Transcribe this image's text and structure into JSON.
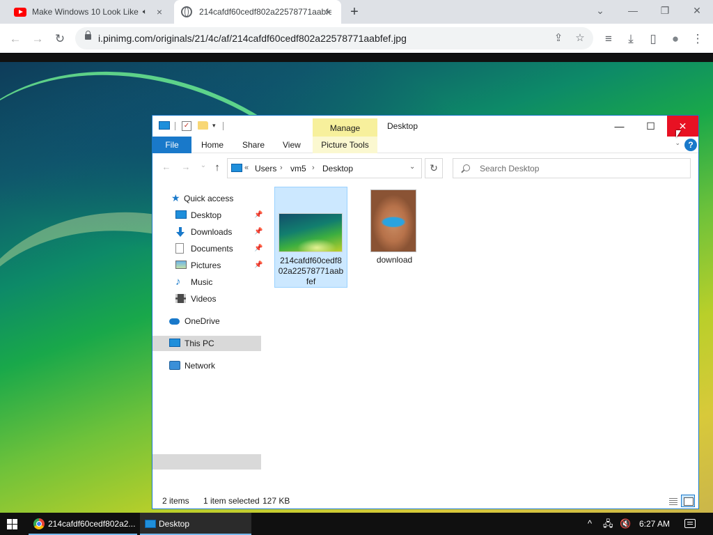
{
  "browser": {
    "tabs": [
      {
        "title": "Make Windows 10 Look Like",
        "close": "×"
      },
      {
        "title": "214cafdf60cedf802a22578771aabfef",
        "close": "×"
      }
    ],
    "new_tab": "+",
    "window_controls": {
      "tab_search": "⌄",
      "minimize": "—",
      "restore": "❐",
      "close": "✕"
    },
    "nav": {
      "back": "←",
      "forward": "→",
      "reload": "↻"
    },
    "url": "i.pinimg.com/originals/21/4c/af/214cafdf60cedf802a22578771aabfef.jpg",
    "omnibox_icons": {
      "share": "⇪",
      "bookmark": "☆"
    },
    "toolbar_icons": {
      "media": "≡",
      "downloads": "⤓",
      "side_panel": "▯",
      "profile": "●",
      "menu": "⋮"
    }
  },
  "explorer": {
    "quick_access_arrow": "▾",
    "manage_label": "Manage",
    "title": "Desktop",
    "controls": {
      "minimize": "—",
      "maximize": "☐",
      "close": "✕"
    },
    "ribbon": {
      "file": "File",
      "home": "Home",
      "share": "Share",
      "view": "View",
      "picture_tools": "Picture Tools",
      "help": "?",
      "collapse": "⌄"
    },
    "nav": {
      "back": "←",
      "forward": "→",
      "recent": "⌄",
      "up": "↑"
    },
    "breadcrumb": {
      "overflow": "«",
      "items": [
        "Users",
        "vm5",
        "Desktop"
      ],
      "separator": "›",
      "dropdown": "⌄"
    },
    "refresh": "↻",
    "search": {
      "placeholder": "Search Desktop"
    },
    "sidebar": {
      "quick_access": "Quick access",
      "items": [
        {
          "label": "Desktop",
          "pin": "📌"
        },
        {
          "label": "Downloads",
          "pin": "📌"
        },
        {
          "label": "Documents",
          "pin": "📌"
        },
        {
          "label": "Pictures",
          "pin": "📌"
        },
        {
          "label": "Music"
        },
        {
          "label": "Videos"
        }
      ],
      "onedrive": "OneDrive",
      "this_pc": "This PC",
      "network": "Network"
    },
    "files": [
      {
        "name": "214cafdf60cedf802a22578771aabfef",
        "selected": true
      },
      {
        "name": "download",
        "selected": false
      }
    ],
    "status": {
      "count": "2 items",
      "selection": "1 item selected",
      "size": "127 KB"
    }
  },
  "taskbar": {
    "chrome_task": "214cafdf60cedf802a2...",
    "explorer_task": "Desktop",
    "tray": {
      "chevron": "^",
      "network": "🖧",
      "volume": "🔇"
    },
    "clock": "6:27 AM"
  }
}
